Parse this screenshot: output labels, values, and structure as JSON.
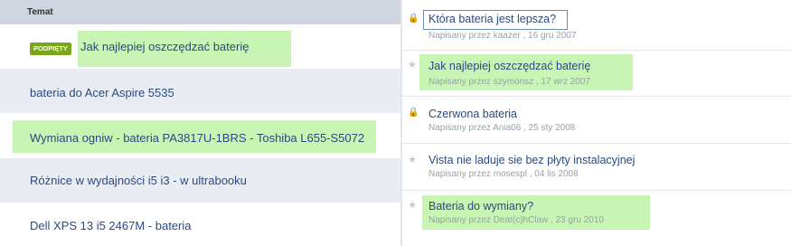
{
  "left": {
    "header": "Temat",
    "badge": "PODPIĘTY",
    "topics": [
      {
        "title": "Jak najlepiej oszczędzać baterię"
      },
      {
        "title": "bateria do Acer Aspire 5535"
      },
      {
        "title": "Wymiana ogniw - bateria PA3817U-1BRS - Toshiba L655-S5072"
      },
      {
        "title": "Różnice w wydajności i5 i3 - w ultrabooku"
      },
      {
        "title": "Dell XPS 13 i5 2467M - bateria"
      }
    ]
  },
  "right": {
    "topics": [
      {
        "icon": "lock-icon",
        "title": "Która bateria jest lepsza?",
        "meta": "Napisany przez kaazer , 16 gru 2007"
      },
      {
        "icon": "star-icon",
        "title": "Jak najlepiej oszczędzać baterię",
        "meta": "Napisany przez szymonsz , 17 wrz 2007"
      },
      {
        "icon": "lock-icon",
        "title": "Czerwona bateria",
        "meta": "Napisany przez Ania06 , 25 sty 2008"
      },
      {
        "icon": "star-icon",
        "title": "Vista nie laduje sie bez płyty instalacyjnej",
        "meta": "Napisany przez mosespl , 04 lis 2008"
      },
      {
        "icon": "star-icon",
        "title": "Bateria do wymiany?",
        "meta": "Napisany przez Deat(c)hClaw , 23 gru 2010"
      }
    ]
  }
}
